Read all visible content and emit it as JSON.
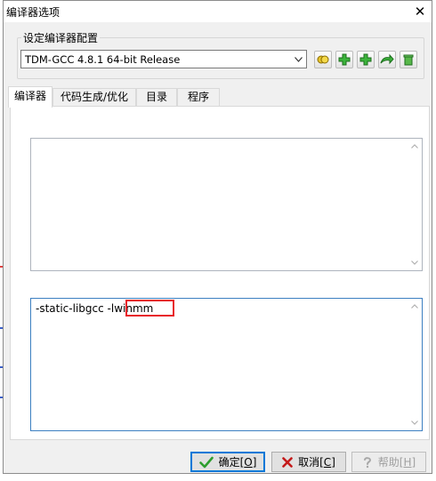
{
  "window": {
    "title": "编译器选项",
    "close_symbol": "✕"
  },
  "compiler_set": {
    "group_label": "设定编译器配置",
    "selected": "TDM-GCC 4.8.1 64-bit Release",
    "toolbar_icons": [
      "copy-config-icon",
      "add-config-icon",
      "add-config-folder-icon",
      "rename-config-icon",
      "delete-config-icon"
    ]
  },
  "tabs": [
    {
      "label": "编译器",
      "active": true
    },
    {
      "label": "代码生成/优化",
      "active": false
    },
    {
      "label": "目录",
      "active": false
    },
    {
      "label": "程序",
      "active": false
    }
  ],
  "compile_commands": {
    "text": ""
  },
  "linker_commands": {
    "prefix": "-static-libgcc ",
    "highlighted": "-lwinmm"
  },
  "buttons": {
    "ok": {
      "label": "确定[",
      "key": "O",
      "suffix": "]"
    },
    "cancel": {
      "label": "取消[",
      "key": "C",
      "suffix": "]"
    },
    "help": {
      "label": "帮助[",
      "key": "H",
      "suffix": "]"
    }
  },
  "colors": {
    "highlight": "#e8232a",
    "focus_border": "#3c7fc1",
    "icon_green": "#2e9e2e",
    "icon_yellow": "#d9b41a"
  }
}
